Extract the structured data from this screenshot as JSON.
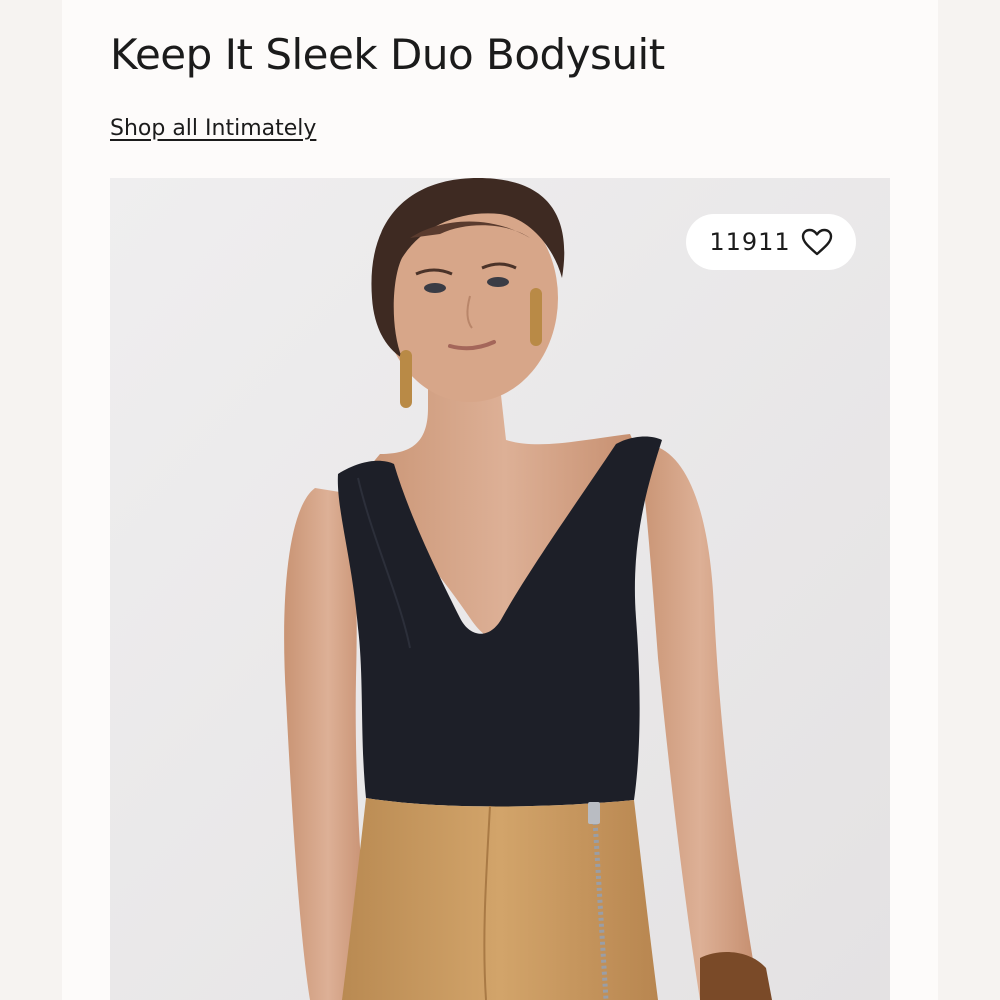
{
  "product": {
    "title": "Keep It Sleek Duo Bodysuit",
    "shop_link": "Shop all Intimately"
  },
  "like": {
    "count": "11911",
    "icon": "heart-outline-icon"
  },
  "photo": {
    "subject": "product-photo",
    "background_color": "#ecebec",
    "bodysuit_color": "#1d1f28",
    "skirt_color": "#c99a5f"
  }
}
